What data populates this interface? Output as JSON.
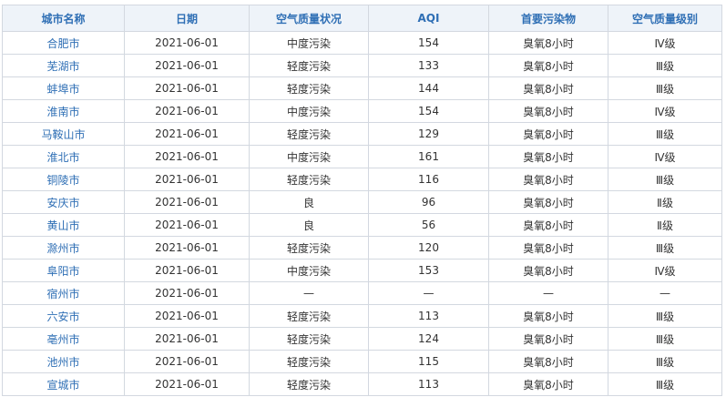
{
  "table": {
    "headers": [
      "城市名称",
      "日期",
      "空气质量状况",
      "AQI",
      "首要污染物",
      "空气质量级别"
    ],
    "rows": [
      [
        "合肥市",
        "2021-06-01",
        "中度污染",
        "154",
        "臭氧8小时",
        "Ⅳ级"
      ],
      [
        "芜湖市",
        "2021-06-01",
        "轻度污染",
        "133",
        "臭氧8小时",
        "Ⅲ级"
      ],
      [
        "蚌埠市",
        "2021-06-01",
        "轻度污染",
        "144",
        "臭氧8小时",
        "Ⅲ级"
      ],
      [
        "淮南市",
        "2021-06-01",
        "中度污染",
        "154",
        "臭氧8小时",
        "Ⅳ级"
      ],
      [
        "马鞍山市",
        "2021-06-01",
        "轻度污染",
        "129",
        "臭氧8小时",
        "Ⅲ级"
      ],
      [
        "淮北市",
        "2021-06-01",
        "中度污染",
        "161",
        "臭氧8小时",
        "Ⅳ级"
      ],
      [
        "铜陵市",
        "2021-06-01",
        "轻度污染",
        "116",
        "臭氧8小时",
        "Ⅲ级"
      ],
      [
        "安庆市",
        "2021-06-01",
        "良",
        "96",
        "臭氧8小时",
        "Ⅱ级"
      ],
      [
        "黄山市",
        "2021-06-01",
        "良",
        "56",
        "臭氧8小时",
        "Ⅱ级"
      ],
      [
        "滁州市",
        "2021-06-01",
        "轻度污染",
        "120",
        "臭氧8小时",
        "Ⅲ级"
      ],
      [
        "阜阳市",
        "2021-06-01",
        "中度污染",
        "153",
        "臭氧8小时",
        "Ⅳ级"
      ],
      [
        "宿州市",
        "2021-06-01",
        "—",
        "—",
        "—",
        "—"
      ],
      [
        "六安市",
        "2021-06-01",
        "轻度污染",
        "113",
        "臭氧8小时",
        "Ⅲ级"
      ],
      [
        "亳州市",
        "2021-06-01",
        "轻度污染",
        "124",
        "臭氧8小时",
        "Ⅲ级"
      ],
      [
        "池州市",
        "2021-06-01",
        "轻度污染",
        "115",
        "臭氧8小时",
        "Ⅲ级"
      ],
      [
        "宣城市",
        "2021-06-01",
        "轻度污染",
        "113",
        "臭氧8小时",
        "Ⅲ级"
      ]
    ]
  },
  "colors": {
    "header_text": "#2f6fb5",
    "header_bg": "#eef3f9",
    "city_text": "#2f6fb5",
    "cell_text": "#333333",
    "border": "#d3d8e0"
  }
}
